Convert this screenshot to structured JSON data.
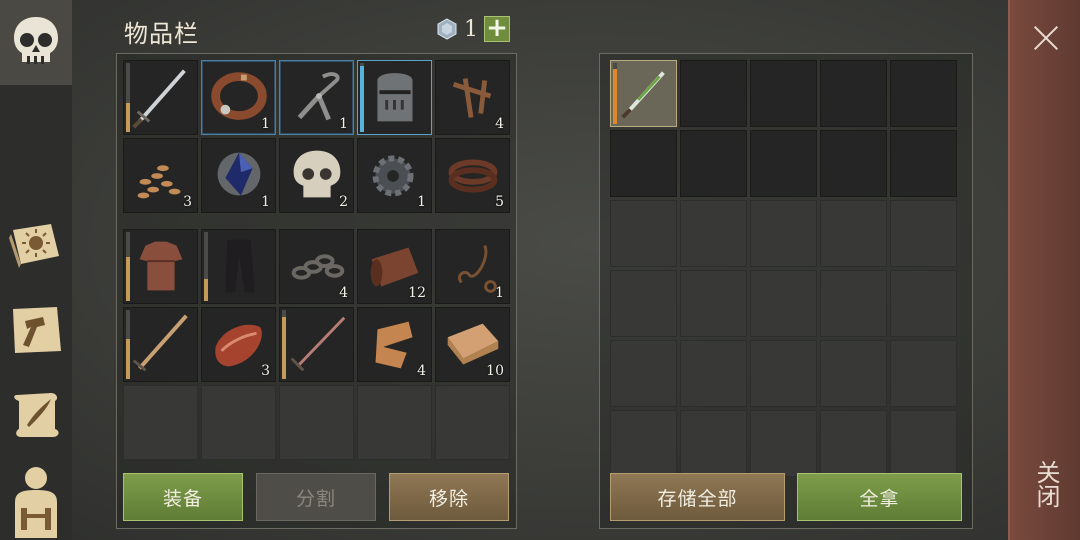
{
  "inventory": {
    "title": "物品栏",
    "currency": {
      "icon": "gem-icon",
      "count": "1",
      "add_label": "+"
    }
  },
  "top_slots": [
    {
      "icon": "sword-icon",
      "qty": "",
      "durability": 0.6
    },
    {
      "icon": "leather-collar-icon",
      "qty": "1"
    },
    {
      "icon": "pliers-icon",
      "qty": "1"
    },
    {
      "icon": "knight-helmet-icon",
      "qty": "",
      "durability": 0.9
    },
    {
      "icon": "nails-icon",
      "qty": "4"
    },
    {
      "icon": "seeds-icon",
      "qty": "3"
    },
    {
      "icon": "crystal-icon",
      "qty": "1"
    },
    {
      "icon": "skull-icon",
      "qty": "2"
    },
    {
      "icon": "gear-icon",
      "qty": "1"
    },
    {
      "icon": "leather-strips-icon",
      "qty": "5"
    }
  ],
  "bottom_slots": [
    {
      "icon": "chainmail-shirt-icon",
      "qty": "",
      "durability": 0.6
    },
    {
      "icon": "pants-icon",
      "qty": "",
      "durability": 0.3
    },
    {
      "icon": "chain-icon",
      "qty": "4"
    },
    {
      "icon": "leather-roll-icon",
      "qty": "12"
    },
    {
      "icon": "rope-icon",
      "qty": "1"
    },
    {
      "icon": "longsword-icon",
      "qty": "",
      "durability": 0.55
    },
    {
      "icon": "raw-meat-icon",
      "qty": "3"
    },
    {
      "icon": "rapier-icon",
      "qty": "",
      "durability": 0.85
    },
    {
      "icon": "scarf-icon",
      "qty": "4"
    },
    {
      "icon": "cloth-icon",
      "qty": "10"
    }
  ],
  "buttons": {
    "equip": "装备",
    "split": "分割",
    "remove": "移除",
    "store_all": "存储全部",
    "take_all": "全拿"
  },
  "storage": {
    "first_item": {
      "icon": "poisoned-dagger-icon",
      "durability": 0.85
    }
  },
  "close": {
    "label": "关闭"
  },
  "sidebar": [
    "skull-tab-icon",
    "sun-book-icon",
    "craft-hammer-icon",
    "scroll-quill-icon",
    "character-icon"
  ],
  "colors": {
    "accent_green": "#6f8d3c",
    "durability_tan": "#c59b5a",
    "durability_orange": "#e0862c",
    "close_red": "#6b4035"
  }
}
